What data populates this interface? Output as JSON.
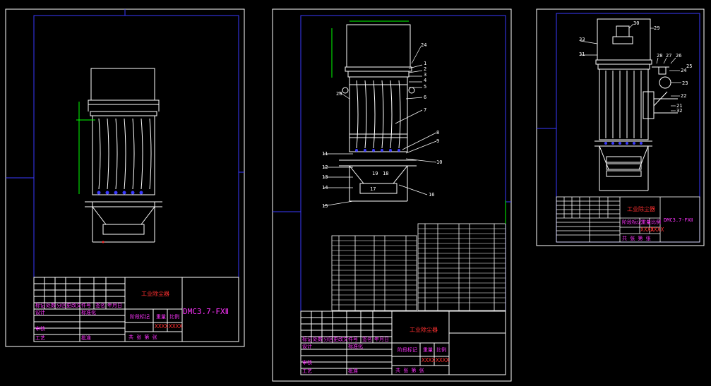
{
  "colors": {
    "background": "#000000",
    "sheet_border": "#ffffff",
    "frame": "#3a3aff",
    "line": "#ffffff",
    "label_magenta": "#ff33ff",
    "label_red": "#ff3030",
    "dim_green": "#00ff00"
  },
  "sheet1": {
    "title_block": {
      "company": "工业除尘器",
      "model": "DMC3.7-FXⅡ",
      "mark": "标记",
      "count": "处数",
      "zone": "分区",
      "change_doc": "更改文件号",
      "sign": "签名",
      "date": "年月日",
      "design": "设计",
      "standardize": "标准化",
      "review": "审核",
      "process": "工艺",
      "approve": "批准",
      "stage_mark": "阶段标记",
      "weight": "重量",
      "scale": "比例",
      "weight_val": "XXXX",
      "scale_val": "XXXX",
      "sheets": "共 张 第 张"
    }
  },
  "sheet2": {
    "part_numbers": [
      "24",
      "1",
      "2",
      "3",
      "4",
      "5",
      "6",
      "7",
      "8",
      "9",
      "10",
      "11",
      "12",
      "13",
      "14",
      "15",
      "16",
      "19",
      "18",
      "17",
      "20"
    ],
    "title_block": {
      "company": "工业除尘器",
      "mark": "标记",
      "count": "处数",
      "zone": "分区",
      "change_doc": "更改文件号",
      "sign": "签名",
      "date": "年月日",
      "design": "设计",
      "standardize": "标准化",
      "review": "审核",
      "process": "工艺",
      "approve": "批准",
      "stage_mark": "阶段标记",
      "weight": "重量",
      "scale": "比例",
      "weight_val": "XXXX",
      "scale_val": "XXXX",
      "sheets": "共 张 第 张"
    }
  },
  "sheet3": {
    "part_numbers": [
      "30",
      "29",
      "33",
      "31",
      "28",
      "27",
      "26",
      "25",
      "24",
      "23",
      "22",
      "21",
      "32"
    ],
    "title_block": {
      "company": "工业除尘器",
      "model": "DMC3.7-FXⅡ",
      "stage_mark": "阶段标记",
      "weight": "重量",
      "scale": "比例",
      "weight_val": "XXXX",
      "scale_val": "XXXX",
      "sheets": "共 张 第 张"
    }
  }
}
